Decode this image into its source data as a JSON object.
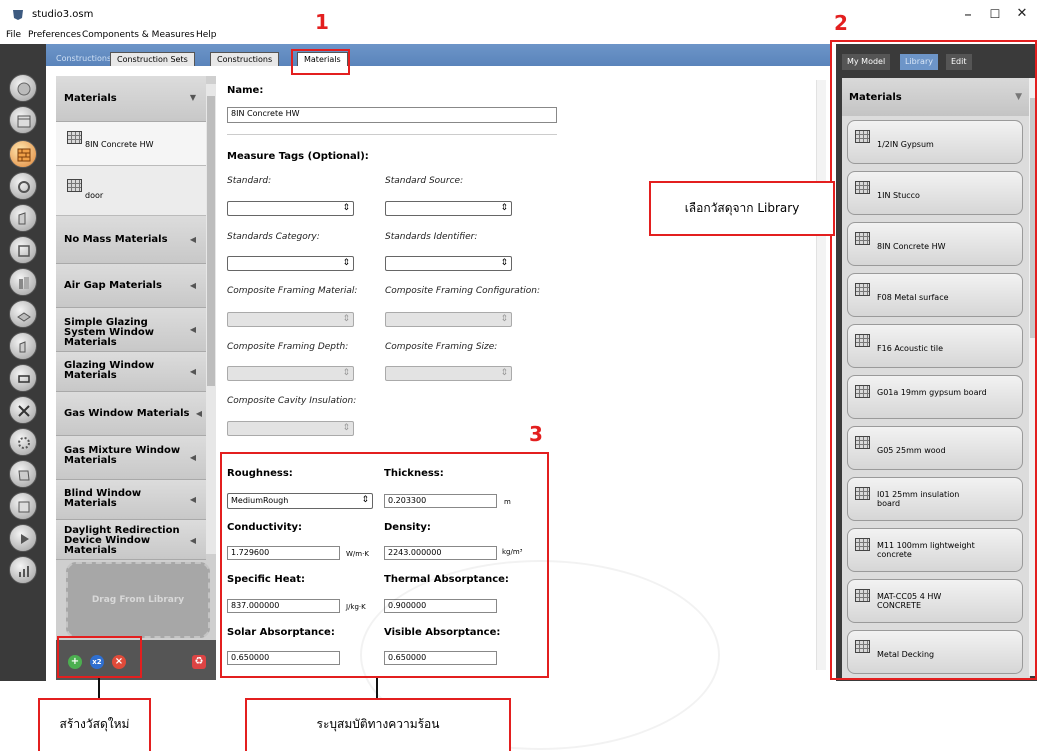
{
  "window": {
    "title": "studio3.osm",
    "controls": [
      "–",
      "☐",
      "✕"
    ]
  },
  "menu": [
    "File",
    "Preferences",
    "Components & Measures",
    "Help"
  ],
  "tabs": {
    "breadcrumb": "Constructions",
    "items": [
      "Construction Sets",
      "Constructions",
      "Materials"
    ],
    "active": "Materials"
  },
  "left_panel": {
    "header": "Materials",
    "my_materials": [
      "8IN Concrete HW",
      "door"
    ],
    "categories": [
      "No Mass Materials",
      "Air Gap Materials",
      "Simple Glazing System Window Materials",
      "Glazing Window Materials",
      "Gas Window Materials",
      "Gas Mixture Window Materials",
      "Blind Window Materials",
      "Daylight Redirection Device Window Materials"
    ],
    "drop_zone": "Drag From Library"
  },
  "inspector": {
    "name_label": "Name:",
    "name_value": "8IN Concrete HW",
    "measure_tags_label": "Measure Tags (Optional):",
    "standard": "Standard:",
    "standard_source": "Standard Source:",
    "standards_category": "Standards Category:",
    "standards_identifier": "Standards Identifier:",
    "composite_framing_material": "Composite Framing Material:",
    "composite_framing_configuration": "Composite Framing Configuration:",
    "composite_framing_depth": "Composite Framing Depth:",
    "composite_framing_size": "Composite Framing Size:",
    "composite_cavity_insulation": "Composite Cavity Insulation:",
    "roughness_label": "Roughness:",
    "roughness_value": "MediumRough",
    "thickness_label": "Thickness:",
    "thickness_value": "0.203300",
    "thickness_unit": "m",
    "conductivity_label": "Conductivity:",
    "conductivity_value": "1.729600",
    "conductivity_unit": "W/m·K",
    "density_label": "Density:",
    "density_value": "2243.000000",
    "density_unit": "kg/m³",
    "specific_heat_label": "Specific Heat:",
    "specific_heat_value": "837.000000",
    "specific_heat_unit": "J/kg·K",
    "thermal_absorptance_label": "Thermal Absorptance:",
    "thermal_absorptance_value": "0.900000",
    "solar_absorptance_label": "Solar Absorptance:",
    "solar_absorptance_value": "0.650000",
    "visible_absorptance_label": "Visible Absorptance:",
    "visible_absorptance_value": "0.650000"
  },
  "right_panel": {
    "tabs": [
      "My Model",
      "Library",
      "Edit"
    ],
    "active_tab": "Library",
    "header": "Materials",
    "items": [
      "1/2IN Gypsum",
      "1IN Stucco",
      "8IN Concrete HW",
      "F08 Metal surface",
      "F16 Acoustic tile",
      "G01a 19mm gypsum board",
      "G05 25mm wood",
      "I01 25mm insulation board",
      "M11 100mm lightweight concrete",
      "MAT-CC05 4 HW CONCRETE",
      "Metal Decking"
    ]
  },
  "annotations": {
    "num1": "1",
    "num2": "2",
    "num3": "3",
    "library_callout": "เลือกวัสดุจาก Library",
    "create_callout": "สร้างวัสดุใหม่",
    "thermal_callout": "ระบุสมบัติทางความร้อน"
  },
  "colors": {
    "annotation_red": "#e31f1f",
    "tab_blue": "#6d95c8",
    "dark_panel": "#3a3a3a"
  }
}
